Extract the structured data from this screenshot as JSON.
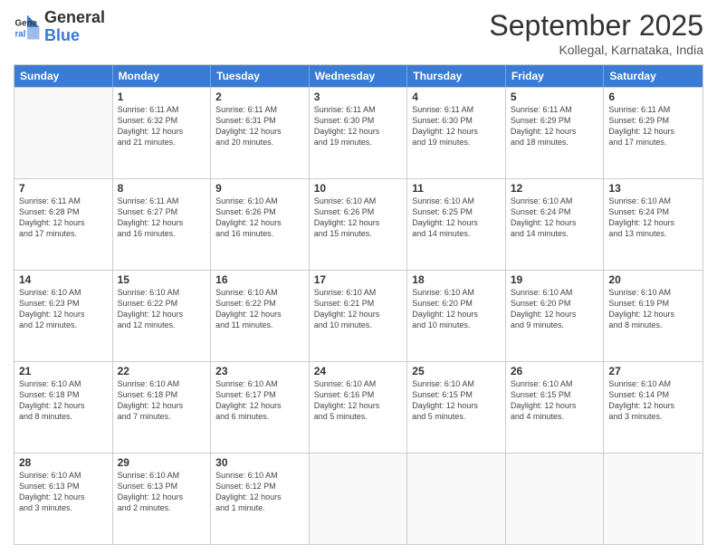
{
  "header": {
    "logo_line1": "General",
    "logo_line2": "Blue",
    "month_title": "September 2025",
    "location": "Kollegal, Karnataka, India"
  },
  "weekdays": [
    "Sunday",
    "Monday",
    "Tuesday",
    "Wednesday",
    "Thursday",
    "Friday",
    "Saturday"
  ],
  "rows": [
    [
      {
        "day": "",
        "info": ""
      },
      {
        "day": "1",
        "info": "Sunrise: 6:11 AM\nSunset: 6:32 PM\nDaylight: 12 hours\nand 21 minutes."
      },
      {
        "day": "2",
        "info": "Sunrise: 6:11 AM\nSunset: 6:31 PM\nDaylight: 12 hours\nand 20 minutes."
      },
      {
        "day": "3",
        "info": "Sunrise: 6:11 AM\nSunset: 6:30 PM\nDaylight: 12 hours\nand 19 minutes."
      },
      {
        "day": "4",
        "info": "Sunrise: 6:11 AM\nSunset: 6:30 PM\nDaylight: 12 hours\nand 19 minutes."
      },
      {
        "day": "5",
        "info": "Sunrise: 6:11 AM\nSunset: 6:29 PM\nDaylight: 12 hours\nand 18 minutes."
      },
      {
        "day": "6",
        "info": "Sunrise: 6:11 AM\nSunset: 6:29 PM\nDaylight: 12 hours\nand 17 minutes."
      }
    ],
    [
      {
        "day": "7",
        "info": "Sunrise: 6:11 AM\nSunset: 6:28 PM\nDaylight: 12 hours\nand 17 minutes."
      },
      {
        "day": "8",
        "info": "Sunrise: 6:11 AM\nSunset: 6:27 PM\nDaylight: 12 hours\nand 16 minutes."
      },
      {
        "day": "9",
        "info": "Sunrise: 6:10 AM\nSunset: 6:26 PM\nDaylight: 12 hours\nand 16 minutes."
      },
      {
        "day": "10",
        "info": "Sunrise: 6:10 AM\nSunset: 6:26 PM\nDaylight: 12 hours\nand 15 minutes."
      },
      {
        "day": "11",
        "info": "Sunrise: 6:10 AM\nSunset: 6:25 PM\nDaylight: 12 hours\nand 14 minutes."
      },
      {
        "day": "12",
        "info": "Sunrise: 6:10 AM\nSunset: 6:24 PM\nDaylight: 12 hours\nand 14 minutes."
      },
      {
        "day": "13",
        "info": "Sunrise: 6:10 AM\nSunset: 6:24 PM\nDaylight: 12 hours\nand 13 minutes."
      }
    ],
    [
      {
        "day": "14",
        "info": "Sunrise: 6:10 AM\nSunset: 6:23 PM\nDaylight: 12 hours\nand 12 minutes."
      },
      {
        "day": "15",
        "info": "Sunrise: 6:10 AM\nSunset: 6:22 PM\nDaylight: 12 hours\nand 12 minutes."
      },
      {
        "day": "16",
        "info": "Sunrise: 6:10 AM\nSunset: 6:22 PM\nDaylight: 12 hours\nand 11 minutes."
      },
      {
        "day": "17",
        "info": "Sunrise: 6:10 AM\nSunset: 6:21 PM\nDaylight: 12 hours\nand 10 minutes."
      },
      {
        "day": "18",
        "info": "Sunrise: 6:10 AM\nSunset: 6:20 PM\nDaylight: 12 hours\nand 10 minutes."
      },
      {
        "day": "19",
        "info": "Sunrise: 6:10 AM\nSunset: 6:20 PM\nDaylight: 12 hours\nand 9 minutes."
      },
      {
        "day": "20",
        "info": "Sunrise: 6:10 AM\nSunset: 6:19 PM\nDaylight: 12 hours\nand 8 minutes."
      }
    ],
    [
      {
        "day": "21",
        "info": "Sunrise: 6:10 AM\nSunset: 6:18 PM\nDaylight: 12 hours\nand 8 minutes."
      },
      {
        "day": "22",
        "info": "Sunrise: 6:10 AM\nSunset: 6:18 PM\nDaylight: 12 hours\nand 7 minutes."
      },
      {
        "day": "23",
        "info": "Sunrise: 6:10 AM\nSunset: 6:17 PM\nDaylight: 12 hours\nand 6 minutes."
      },
      {
        "day": "24",
        "info": "Sunrise: 6:10 AM\nSunset: 6:16 PM\nDaylight: 12 hours\nand 5 minutes."
      },
      {
        "day": "25",
        "info": "Sunrise: 6:10 AM\nSunset: 6:15 PM\nDaylight: 12 hours\nand 5 minutes."
      },
      {
        "day": "26",
        "info": "Sunrise: 6:10 AM\nSunset: 6:15 PM\nDaylight: 12 hours\nand 4 minutes."
      },
      {
        "day": "27",
        "info": "Sunrise: 6:10 AM\nSunset: 6:14 PM\nDaylight: 12 hours\nand 3 minutes."
      }
    ],
    [
      {
        "day": "28",
        "info": "Sunrise: 6:10 AM\nSunset: 6:13 PM\nDaylight: 12 hours\nand 3 minutes."
      },
      {
        "day": "29",
        "info": "Sunrise: 6:10 AM\nSunset: 6:13 PM\nDaylight: 12 hours\nand 2 minutes."
      },
      {
        "day": "30",
        "info": "Sunrise: 6:10 AM\nSunset: 6:12 PM\nDaylight: 12 hours\nand 1 minute."
      },
      {
        "day": "",
        "info": ""
      },
      {
        "day": "",
        "info": ""
      },
      {
        "day": "",
        "info": ""
      },
      {
        "day": "",
        "info": ""
      }
    ]
  ]
}
